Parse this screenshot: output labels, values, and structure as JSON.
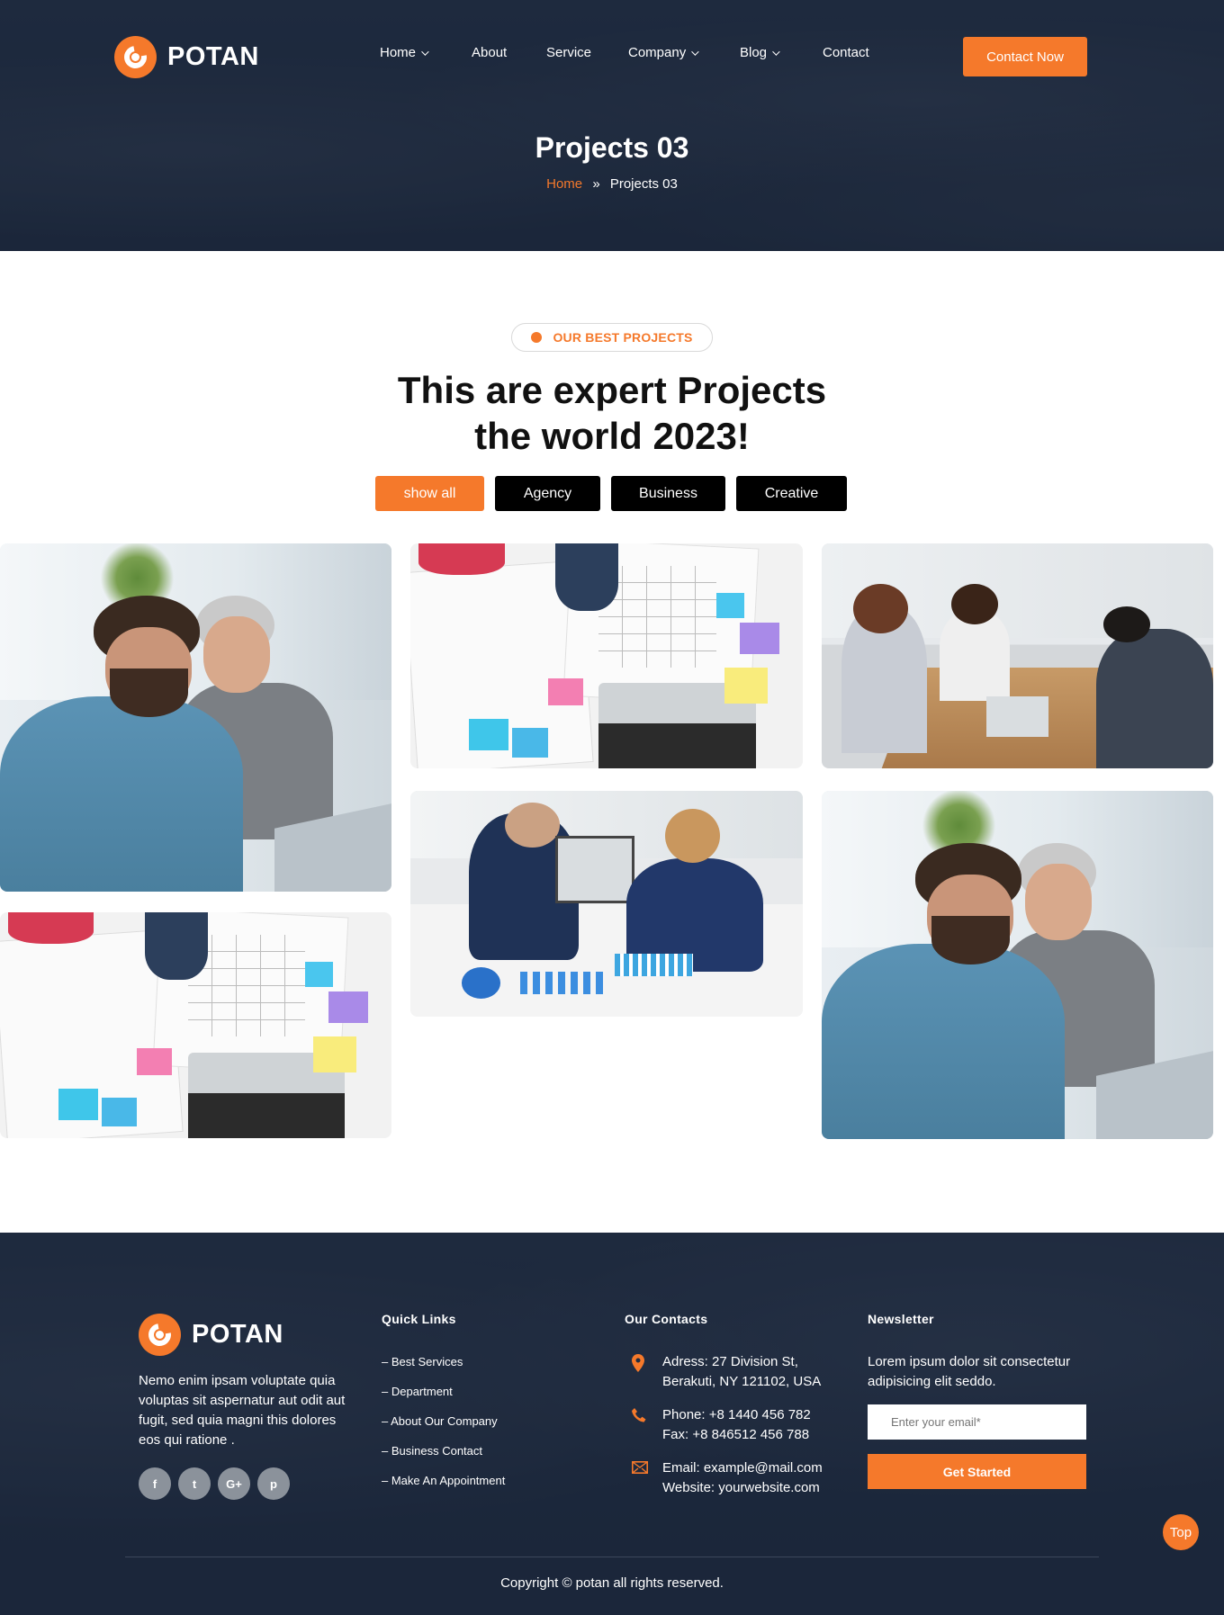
{
  "brand": {
    "name": "POTAN",
    "accent": "#f5792b",
    "dark_bg": "#1f2b40"
  },
  "header": {
    "nav": [
      {
        "label": "Home",
        "dropdown": true
      },
      {
        "label": "About",
        "dropdown": false
      },
      {
        "label": "Service",
        "dropdown": false
      },
      {
        "label": "Company",
        "dropdown": true
      },
      {
        "label": "Blog",
        "dropdown": true
      },
      {
        "label": "Contact",
        "dropdown": false
      }
    ],
    "cta_label": "Contact Now"
  },
  "hero": {
    "title": "Projects 03",
    "breadcrumb": {
      "home": "Home",
      "separator": "»",
      "current": "Projects 03"
    }
  },
  "projects": {
    "tag": "OUR BEST PROJECTS",
    "title_line1": "This are expert Projects",
    "title_line2": "the world 2023!",
    "filters": [
      {
        "label": "show all",
        "active": true
      },
      {
        "label": "Agency",
        "active": false
      },
      {
        "label": "Business",
        "active": false
      },
      {
        "label": "Creative",
        "active": false
      }
    ]
  },
  "footer": {
    "about": "Nemo enim ipsam voluptate quia voluptas sit aspernatur aut odit aut fugit, sed quia magni this dolores eos qui ratione .",
    "social_icons": [
      "facebook-icon",
      "twitter-icon",
      "google-plus-icon",
      "pinterest-icon"
    ],
    "social_glyphs": [
      "f",
      "t",
      "G+",
      "p"
    ],
    "quick_links_heading": "Quick Links",
    "quick_links": [
      "– Best Services",
      "– Department",
      "– About Our Company",
      "– Business Contact",
      "– Make An Appointment"
    ],
    "contacts_heading": "Our Contacts",
    "address_line1": "Adress: 27 Division St,",
    "address_line2": "Berakuti, NY 121102, USA",
    "phone_line1": "Phone: +8 1440 456 782",
    "phone_line2": "Fax: +8 846512 456 788",
    "email_line1": "Email: example@mail.com",
    "email_line2": "Website: yourwebsite.com",
    "newsletter_heading": "Newsletter",
    "newsletter_text": "Lorem ipsum dolor sit consectetur adipisicing elit seddo.",
    "email_placeholder": "Enter your email*",
    "newsletter_button": "Get Started",
    "copyright": "Copyright © potan all rights reserved."
  },
  "back_to_top": "Top"
}
